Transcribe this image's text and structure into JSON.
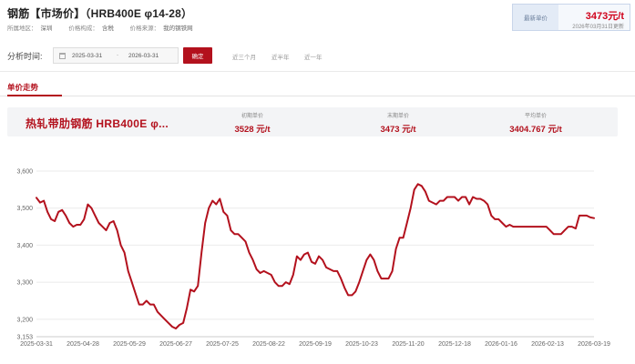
{
  "header": {
    "title": "钢筋【市场价】（HRB400E φ14-28）",
    "meta": [
      {
        "label": "所属地区：",
        "value": "深圳"
      },
      {
        "label": "价格构成：",
        "value": "含税"
      },
      {
        "label": "价格来源：",
        "value": "我的钢铁网"
      }
    ]
  },
  "latest": {
    "label": "最新单价",
    "price": "3473元/t",
    "date": "2026年03月31日更新"
  },
  "filter": {
    "label": "分析时间:",
    "start_date": "2025-03-31",
    "separator": "-",
    "end_date": "2026-03-31",
    "confirm_label": "确定",
    "quick_options": [
      "近三个月",
      "近半年",
      "近一年"
    ]
  },
  "tab": {
    "label": "单价走势"
  },
  "summary": {
    "product_name": "热轧带肋钢筋 HRB400E φ...",
    "stats": [
      {
        "label": "初期单价",
        "value": "3528 元/t"
      },
      {
        "label": "末期单价",
        "value": "3473 元/t"
      },
      {
        "label": "平均单价",
        "value": "3404.767 元/t"
      }
    ]
  },
  "colors": {
    "accent": "#b3111d",
    "line": "#b3111d"
  },
  "chart_data": {
    "type": "line",
    "ylim": [
      3153,
      3600
    ],
    "y_ticks": [
      3153,
      3200,
      3300,
      3400,
      3500,
      3600
    ],
    "y_tick_labels": [
      "3,153",
      "3,200",
      "3,300",
      "3,400",
      "3,500",
      "3,600"
    ],
    "x_ticks": [
      "2025-03-31",
      "2025-04-28",
      "2025-05-29",
      "2025-06-27",
      "2025-07-25",
      "2025-08-22",
      "2025-09-19",
      "2025-10-23",
      "2025-11-20",
      "2025-12-18",
      "2026-01-16",
      "2026-02-13",
      "2026-03-19"
    ],
    "grid": true,
    "series": [
      {
        "values": [
          3528,
          3515,
          3520,
          3490,
          3470,
          3465,
          3490,
          3495,
          3480,
          3460,
          3450,
          3455,
          3455,
          3470,
          3510,
          3500,
          3480,
          3460,
          3450,
          3440,
          3460,
          3465,
          3440,
          3400,
          3380,
          3330,
          3300,
          3270,
          3240,
          3240,
          3250,
          3240,
          3240,
          3220,
          3210,
          3200,
          3190,
          3180,
          3175,
          3185,
          3190,
          3230,
          3280,
          3275,
          3290,
          3380,
          3460,
          3500,
          3520,
          3510,
          3525,
          3490,
          3480,
          3440,
          3430,
          3430,
          3420,
          3410,
          3380,
          3360,
          3335,
          3325,
          3330,
          3325,
          3320,
          3300,
          3290,
          3290,
          3300,
          3295,
          3320,
          3370,
          3360,
          3375,
          3380,
          3355,
          3350,
          3370,
          3360,
          3340,
          3335,
          3330,
          3330,
          3310,
          3285,
          3265,
          3265,
          3275,
          3300,
          3330,
          3360,
          3375,
          3360,
          3330,
          3310,
          3310,
          3310,
          3330,
          3390,
          3420,
          3420,
          3460,
          3500,
          3550,
          3565,
          3560,
          3545,
          3520,
          3515,
          3510,
          3520,
          3520,
          3530,
          3530,
          3530,
          3520,
          3530,
          3530,
          3510,
          3530,
          3525,
          3525,
          3520,
          3510,
          3480,
          3470,
          3470,
          3460,
          3450,
          3455,
          3450,
          3450,
          3450,
          3450,
          3450,
          3450,
          3450,
          3450,
          3450,
          3450,
          3440,
          3430,
          3430,
          3430,
          3440,
          3450,
          3450,
          3445,
          3480,
          3480,
          3480,
          3475,
          3473
        ]
      }
    ]
  }
}
